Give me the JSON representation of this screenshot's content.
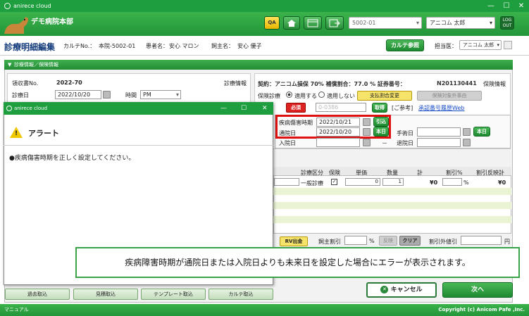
{
  "app_title": "anirece cloud",
  "hospital_name": "デモ病院本部",
  "header": {
    "qa_label": "QA",
    "logout_label": "LOG OUT",
    "code_select": "5002-01",
    "user_select": "アニコム 太郎"
  },
  "page": {
    "title": "診療明細編集",
    "karte_no_label": "カルテNo.：",
    "karte_no": "本院-5002-01",
    "patient_label": "患者名：",
    "patient_name": "安心 マロン",
    "owner_label": "飼主名：",
    "owner_name": "安心 優子",
    "karte_button": "カルテ参照",
    "doctor_label": "担当医：",
    "doctor_select": "アニコム 太郎"
  },
  "section": {
    "title": "診療情報／保険情報"
  },
  "left_panel": {
    "receipt_label": "領収書No.",
    "receipt_no": "2022-70",
    "shinryo_info": "診療情報",
    "date_label": "診療日",
    "date_value": "2022/10/20",
    "time_label": "時間",
    "time_value": "PM"
  },
  "right_panel": {
    "contract_text": "契約：アニコム損保 70% 補償割合：77.0 % 証券番号：",
    "policy_no": "N201130441",
    "insurance_info": "保険情報",
    "insurance_label": "保険診療",
    "apply_label": "適用する",
    "not_apply_label": "適用しない",
    "change_button": "支払割合変更",
    "exclusion_button": "保険対象外事由",
    "required": "必須",
    "claim_placeholder": "0-0386",
    "get_button": "取得",
    "ref_label": "[ご参考]",
    "approval_link": "承認番号履歴Web",
    "injury_label": "疾病傷害時期",
    "injury_value": "2022/10/21",
    "pull_button": "引込",
    "visit_label": "通院日",
    "visit_value": "2022/10/20",
    "today_button": "本日",
    "surgery_label": "手術日",
    "today_button2": "本日",
    "admit_label": "入院日",
    "dash": "－",
    "discharge_label": "退院日"
  },
  "table": {
    "columns": [
      "診療区分",
      "保険",
      "単価",
      "数量",
      "計",
      "割引%",
      "割引反映計"
    ],
    "row": {
      "category": "一般診療",
      "unit_price": "0",
      "qty": "1",
      "total": "¥0",
      "discount_unit": "%",
      "discounted_total": "¥0"
    }
  },
  "lower": {
    "rv_button": "RV出金",
    "owner_discount_label": "飼主割引",
    "percent": "%",
    "reflect_button": "反映",
    "clear_button": "クリア",
    "external_discount_label": "割引外値引",
    "yen": "円"
  },
  "footer_buttons": [
    "過去取込",
    "見積取込",
    "テンプレート取込",
    "カルテ取込"
  ],
  "cancel_button": "キャンセル",
  "next_button": "次へ",
  "manual_label": "マニュアル",
  "copyright": "Copyright (c) Anicom Pafe ,Inc.",
  "alert": {
    "window_title": "anirece cloud",
    "heading": "アラート",
    "message": "●疾病傷害時期を正しく設定してください。"
  },
  "banner_text": "疾病障害時期が通院日または入院日よりも未来日を設定した場合にエラーが表示されます。",
  "colors": {
    "brand_green": "#23963a",
    "alert_yellow": "#f0c800",
    "highlight_red": "#e01010"
  }
}
